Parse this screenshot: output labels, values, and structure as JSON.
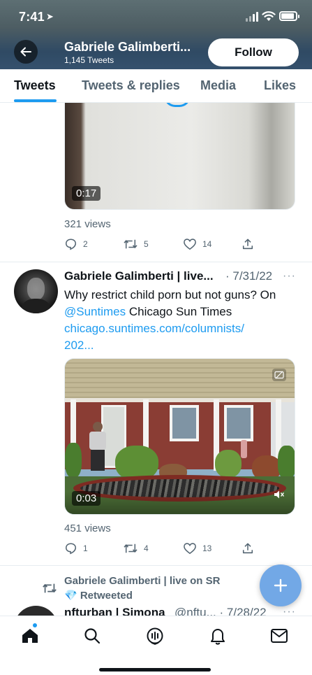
{
  "status_bar": {
    "time": "7:41"
  },
  "header": {
    "name": "Gabriele Galimberti...",
    "tweet_count": "1,145 Tweets",
    "follow_label": "Follow"
  },
  "tabs": [
    {
      "label": "Tweets",
      "active": true
    },
    {
      "label": "Tweets & replies",
      "active": false
    },
    {
      "label": "Media",
      "active": false
    },
    {
      "label": "Likes",
      "active": false
    }
  ],
  "tweets": [
    {
      "video_duration": "0:17",
      "views": "321 views",
      "replies": "2",
      "retweets": "5",
      "likes": "14"
    },
    {
      "author": "Gabriele Galimberti | live...",
      "date": "· 7/31/22",
      "text_line1": "Why restrict child porn but not guns? On",
      "mention": "@Suntimes",
      "text_after_mention": " Chicago Sun Times",
      "link_line1": "chicago.suntimes.com/columnists/",
      "link_line2": "202...",
      "video_duration": "0:03",
      "views": "451 views",
      "replies": "1",
      "retweets": "4",
      "likes": "13"
    }
  ],
  "retweet_context": {
    "line1": "Gabriele Galimberti | live on SR",
    "line2": "💎 Retweeted"
  },
  "next_tweet": {
    "author": "nfturban | Simona",
    "handle": "@nftu...",
    "date": "· 7/28/22"
  },
  "colors": {
    "accent": "#1d9bf0",
    "fab": "#72a8e6"
  }
}
